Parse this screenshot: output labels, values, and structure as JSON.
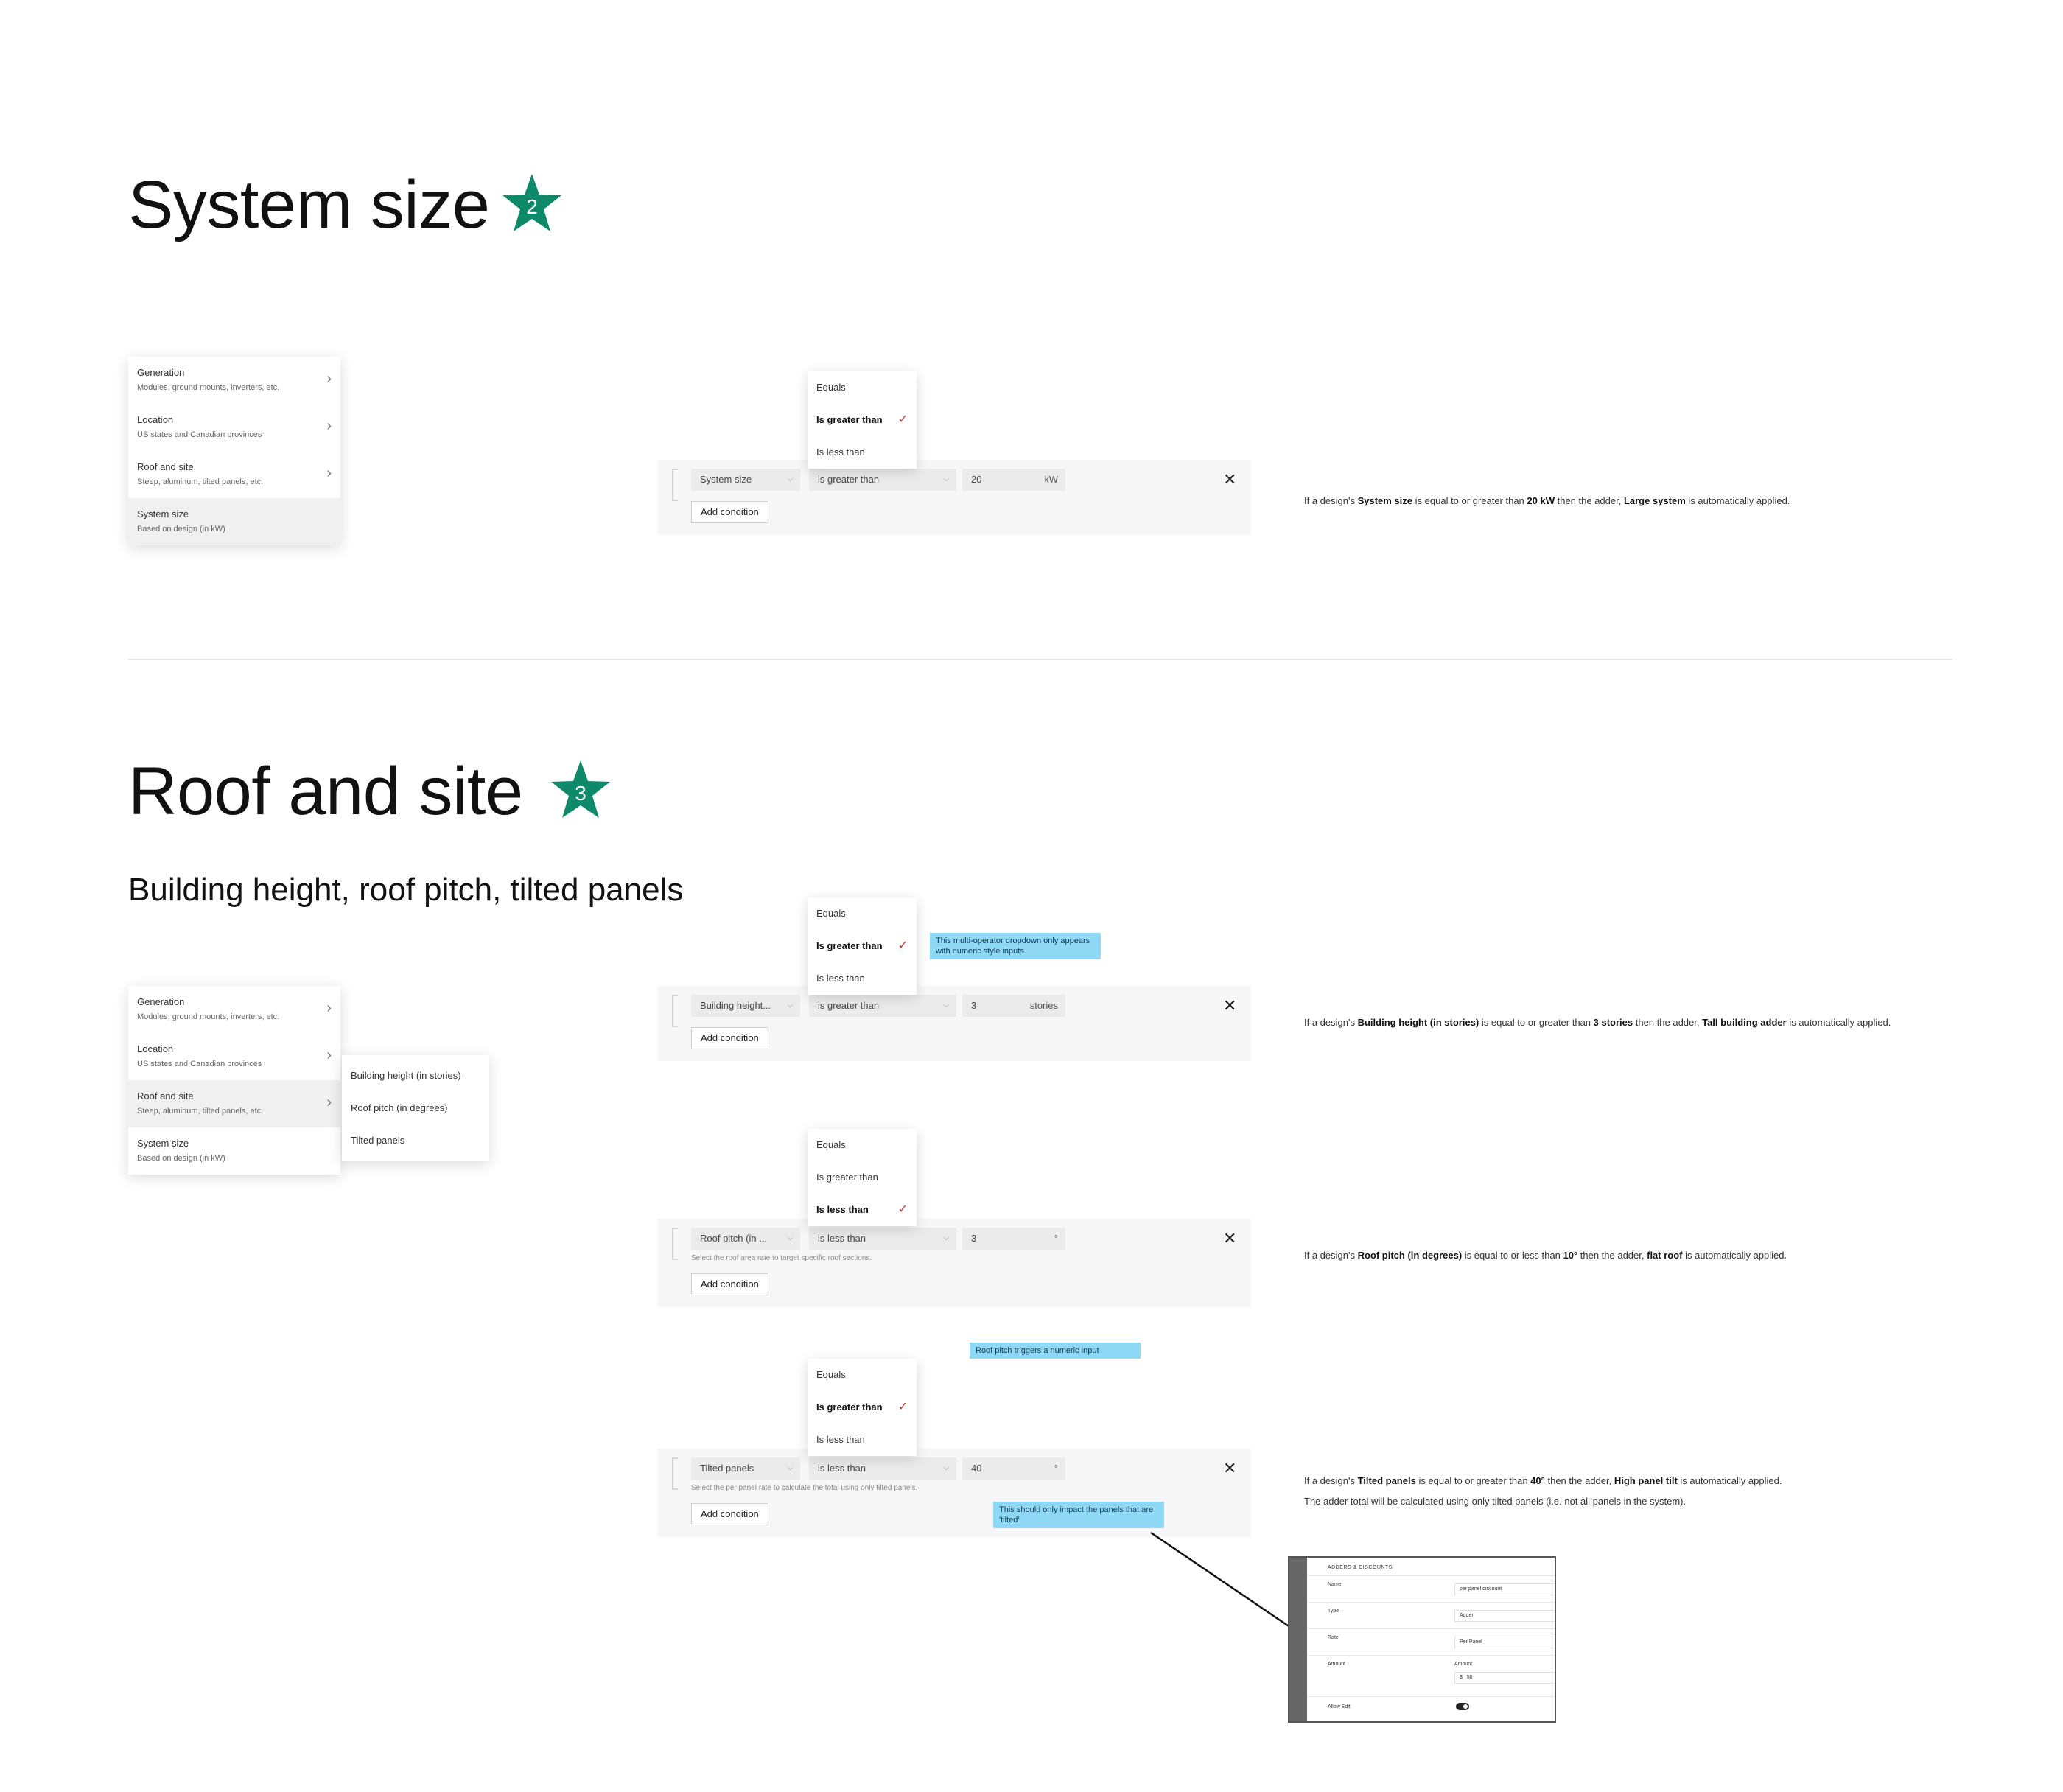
{
  "colors": {
    "star": "#0e8a6a",
    "note_bg": "#8fd8f6",
    "check": "#c0392b"
  },
  "sections": {
    "system_size": {
      "title": "System size",
      "badge": "2",
      "menu": [
        {
          "title": "Generation",
          "subtitle": "Modules, ground mounts, inverters, etc."
        },
        {
          "title": "Location",
          "subtitle": "US states and Canadian provinces"
        },
        {
          "title": "Roof and site",
          "subtitle": "Steep, aluminum, tilted panels, etc."
        },
        {
          "title": "System size",
          "subtitle": "Based on design (in kW)"
        }
      ],
      "operators": [
        "Equals",
        "Is greater than",
        "Is less than"
      ],
      "condition": {
        "field": "System size",
        "operator": "is greater than",
        "value": "20",
        "unit": "kW",
        "add_label": "Add condition"
      },
      "description": {
        "p1": "If a design's ",
        "b1": "System size",
        "p2": " is equal to or greater than ",
        "b2": "20 kW",
        "p3": "  then the adder, ",
        "b3": "Large system",
        "p4": " is automatically applied."
      }
    },
    "roof_site": {
      "title": "Roof and site",
      "badge": "3",
      "subtitle": "Building height, roof pitch, tilted panels",
      "menu": [
        {
          "title": "Generation",
          "subtitle": "Modules, ground mounts, inverters, etc."
        },
        {
          "title": "Location",
          "subtitle": "US states and Canadian provinces"
        },
        {
          "title": "Roof and site",
          "subtitle": "Steep, aluminum, tilted panels, etc."
        },
        {
          "title": "System size",
          "subtitle": "Based on design (in kW)"
        }
      ],
      "submenu": [
        "Building height (in stories)",
        "Roof pitch (in degrees)",
        "Tilted panels"
      ],
      "building": {
        "operators": [
          "Equals",
          "Is greater than",
          "Is less than"
        ],
        "note": "This multi-operator dropdown only appears with numeric style inputs.",
        "field": "Building height...",
        "operator": "is greater than",
        "value": "3",
        "unit": "stories",
        "add_label": "Add condition",
        "description": {
          "p1": "If a design's ",
          "b1": "Building height (in stories)",
          "p2": " is equal to or greater than ",
          "b2": "3 stories",
          "p3": " then the adder, ",
          "b3": "Tall building adder",
          "p4": " is automatically applied."
        }
      },
      "pitch": {
        "operators": [
          "Equals",
          "Is greater than",
          "Is less than"
        ],
        "field": "Roof pitch (in ...",
        "operator": "is less than",
        "value": "3",
        "unit": "°",
        "helper": "Select the roof area rate to target specific roof sections.",
        "add_label": "Add condition",
        "note": "Roof pitch triggers a numeric input",
        "description": {
          "p1": "If a design's ",
          "b1": "Roof pitch (in degrees)",
          "p2": " is equal to or less than ",
          "b2": "10°",
          "p3": " then the adder, ",
          "b3": "flat roof",
          "p4": " is automatically applied."
        }
      },
      "tilted": {
        "operators": [
          "Equals",
          "Is greater than",
          "Is less than"
        ],
        "field": "Tilted panels",
        "operator": "is less than",
        "value": "40",
        "unit": "°",
        "helper": "Select the per panel rate to calculate the total using only tilted panels.",
        "add_label": "Add condition",
        "note": "This should only impact the panels that are 'tilted'",
        "description": {
          "p1": "If a design's ",
          "b1": "Tilted panels",
          "p2": " is equal to or greater than ",
          "b2": "40°",
          "p3": " then the adder, ",
          "b3": "High panel tilt",
          "p4": " is automatically applied."
        },
        "description2": "The adder total will be calculated using only tilted panels (i.e. not all panels in the system)."
      },
      "panel": {
        "title": "ADDERS & DISCOUNTS",
        "name_label": "Name",
        "name_value": "per panel discount",
        "type_label": "Type",
        "type_value": "Adder",
        "rate_label": "Rate",
        "rate_value": "Per Panel",
        "amount_label": "Amount",
        "amount_sublabel": "Amount",
        "currency": "$",
        "amount_value": "50",
        "allow_edit_label": "Allow Edit",
        "allow_edit_on": true
      }
    }
  }
}
